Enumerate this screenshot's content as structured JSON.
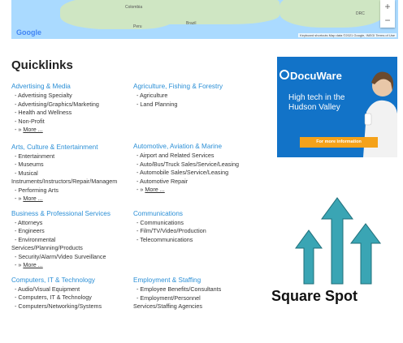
{
  "map": {
    "logo": "Google",
    "labels": [
      "Colombia",
      "Peru",
      "Brazil",
      "DRC"
    ],
    "attribution": "Keyboard shortcuts   Map data ©2021 Google, INEGI   Terms of Use",
    "zoom_in": "+",
    "zoom_out": "−"
  },
  "quicklinks": {
    "title": "Quicklinks",
    "left": [
      {
        "name": "Advertising & Media",
        "items": [
          "- Advertising Specialty",
          "- Advertising/Graphics/Marketing",
          "- Health and Wellness",
          "- Non-Profit"
        ],
        "more": "More ..."
      },
      {
        "name": "Arts, Culture & Entertainment",
        "items": [
          "- Entertainment",
          "- Museums",
          "- Musical",
          "Instruments/Instructors/Repair/Managem",
          "- Performing Arts"
        ],
        "more": "More ..."
      },
      {
        "name": "Business & Professional Services",
        "items": [
          "- Attorneys",
          "- Engineers",
          "- Environmental",
          "Services/Planning/Products",
          "- Security/Alarm/Video Surveillance"
        ],
        "more": "More ..."
      },
      {
        "name": "Computers, IT & Technology",
        "items": [
          "- Audio/Visual Equipment",
          "- Computers, IT & Technology",
          "- Computers/Networking/Systems"
        ]
      }
    ],
    "right": [
      {
        "name": "Agriculture, Fishing & Forestry",
        "items": [
          "- Agriculture",
          "- Land Planning"
        ]
      },
      {
        "name": "Automotive, Aviation & Marine",
        "items": [
          "- Airport and Related Services",
          "- Auto/Bus/Truck Sales/Service/Leasing",
          "- Automobile Sales/Service/Leasing",
          "- Automotive Repair"
        ],
        "more": "More ..."
      },
      {
        "name": "Communications",
        "items": [
          "- Communications",
          "- Film/TV/Video/Production",
          "- Telecommunications"
        ]
      },
      {
        "name": "Employment & Staffing",
        "items": [
          "- Employee Benefits/Consultants",
          "- Employment/Personnel",
          "Services/Staffing Agencies"
        ]
      }
    ]
  },
  "ad": {
    "brand": "DocuWare",
    "tagline": "High tech in the Hudson Valley",
    "cta": "For more information",
    "bg_color": "#1273c8",
    "cta_color": "#f5a21a"
  },
  "sponsor": {
    "name": "Square Spot",
    "icon": "three-up-arrows-logo",
    "color": "#3aa5b4"
  }
}
